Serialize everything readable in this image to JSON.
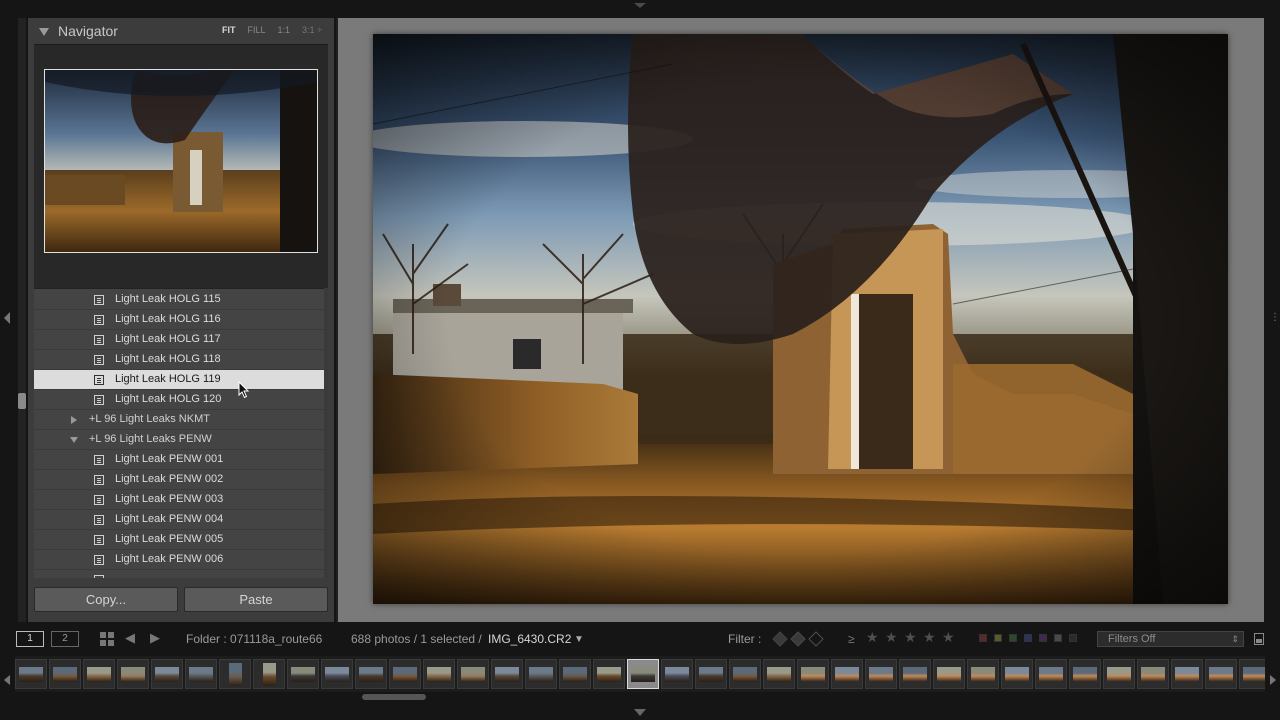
{
  "navigator": {
    "title": "Navigator",
    "zoom_options": [
      "FIT",
      "FILL",
      "1:1",
      "3:1"
    ],
    "active_zoom": "FIT"
  },
  "presets": {
    "rows": [
      {
        "label": "Light Leak HOLG 115",
        "type": "preset",
        "selected": false
      },
      {
        "label": "Light Leak HOLG 116",
        "type": "preset",
        "selected": false
      },
      {
        "label": "Light Leak HOLG 117",
        "type": "preset",
        "selected": false
      },
      {
        "label": "Light Leak HOLG 118",
        "type": "preset",
        "selected": false
      },
      {
        "label": "Light Leak HOLG 119",
        "type": "preset",
        "selected": true
      },
      {
        "label": "Light Leak HOLG 120",
        "type": "preset",
        "selected": false
      },
      {
        "label": "+L 96 Light Leaks NKMT",
        "type": "folder",
        "expanded": false
      },
      {
        "label": "+L 96 Light Leaks PENW",
        "type": "folder",
        "expanded": true
      },
      {
        "label": "Light Leak PENW 001",
        "type": "preset",
        "selected": false
      },
      {
        "label": "Light Leak PENW 002",
        "type": "preset",
        "selected": false
      },
      {
        "label": "Light Leak PENW 003",
        "type": "preset",
        "selected": false
      },
      {
        "label": "Light Leak PENW 004",
        "type": "preset",
        "selected": false
      },
      {
        "label": "Light Leak PENW 005",
        "type": "preset",
        "selected": false
      },
      {
        "label": "Light Leak PENW 006",
        "type": "preset",
        "selected": false
      }
    ]
  },
  "buttons": {
    "copy": "Copy...",
    "paste": "Paste"
  },
  "toolbar": {
    "view1": "1",
    "view2": "2",
    "folder": "Folder : 071118a_route66",
    "count": "688 photos / 1 selected /",
    "filename": "IMG_6430.CR2",
    "filter_label": "Filter :",
    "rating_op": "≥",
    "filters_value": "Filters Off"
  },
  "colors": {
    "panel_bg": "#3c3c3c",
    "selected_row": "#dcdcdc",
    "main_bg": "#7a7a7a",
    "label_red": "#6a2a2a",
    "label_yellow": "#6a6a2a",
    "label_green": "#2a5a2a",
    "label_blue": "#2a3a6a",
    "label_purple": "#4a2a5a"
  },
  "filmstrip": {
    "selected_index": 18
  }
}
